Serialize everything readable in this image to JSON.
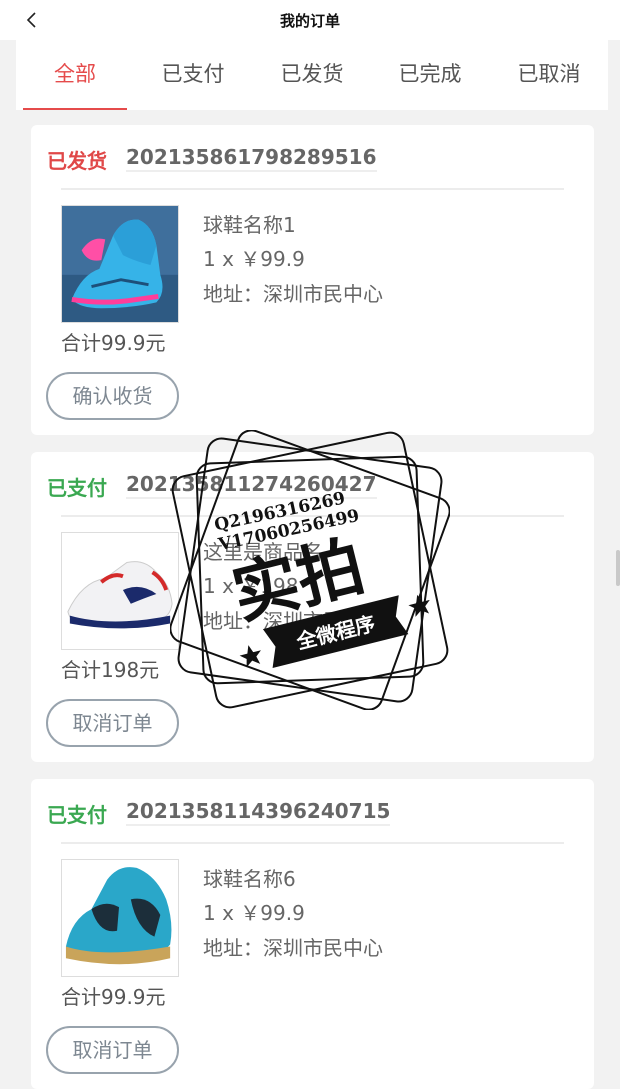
{
  "header": {
    "title": "我的订单",
    "back_icon": "chevron-left-icon"
  },
  "tabs": [
    {
      "label": "全部",
      "active": true
    },
    {
      "label": "已支付",
      "active": false
    },
    {
      "label": "已发货",
      "active": false
    },
    {
      "label": "已完成",
      "active": false
    },
    {
      "label": "已取消",
      "active": false
    }
  ],
  "orders": [
    {
      "status": "已发货",
      "status_color": "#e04848",
      "order_no": "202135861798289516",
      "product_name": "球鞋名称1",
      "qty_price": "1 x ￥99.9",
      "address": "地址：深圳市民中心",
      "total": "合计99.9元",
      "action": "确认收货"
    },
    {
      "status": "已支付",
      "status_color": "#3aa851",
      "order_no": "202135811274260427",
      "product_name": "这里是商品名",
      "qty_price": "1 x ￥198",
      "address": "地址：深圳市民中心",
      "total": "合计198元",
      "action": "取消订单"
    },
    {
      "status": "已支付",
      "status_color": "#3aa851",
      "order_no": "202135811439624071​5",
      "product_name": "球鞋名称6",
      "qty_price": "1 x ￥99.9",
      "address": "地址：深圳市民中心",
      "total": "合计99.9元",
      "action": "取消订单"
    }
  ],
  "watermark": {
    "line1": "Q2196316269",
    "line2": "V17060256499",
    "big": "实拍",
    "ribbon": "全微程序"
  },
  "colors": {
    "accent": "#e54b4b",
    "paid": "#3aa851",
    "shipped": "#e04848"
  }
}
